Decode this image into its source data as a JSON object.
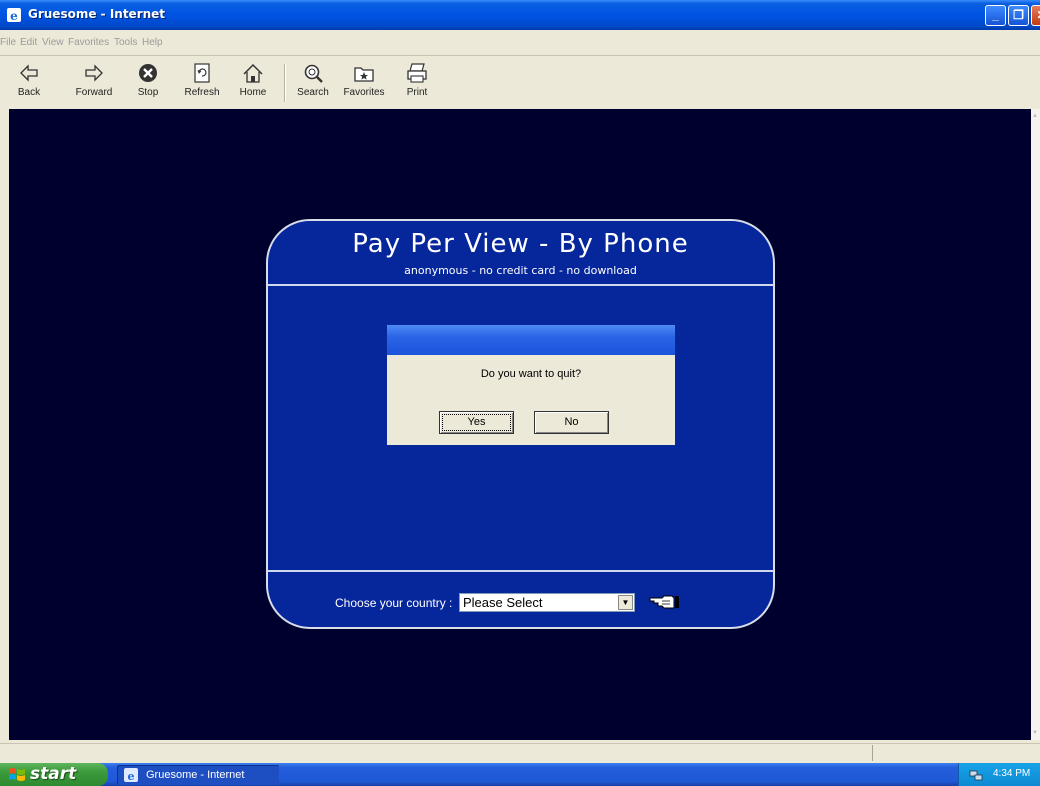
{
  "window": {
    "title": "Gruesome - Internet"
  },
  "menu": {
    "items": [
      "File",
      "Edit",
      "View",
      "Favorites",
      "Tools",
      "Help"
    ]
  },
  "toolbar": {
    "buttons": [
      {
        "label": "Back",
        "icon": "back-arrow-icon"
      },
      {
        "label": "Forward",
        "icon": "forward-arrow-icon"
      },
      {
        "label": "Stop",
        "icon": "stop-icon"
      },
      {
        "label": "Refresh",
        "icon": "refresh-icon"
      },
      {
        "label": "Home",
        "icon": "home-icon"
      },
      {
        "label": "Search",
        "icon": "search-icon"
      },
      {
        "label": "Favorites",
        "icon": "favorites-icon"
      },
      {
        "label": "Print",
        "icon": "print-icon"
      }
    ]
  },
  "ppv": {
    "title": "Pay Per View - By Phone",
    "subtitle": "anonymous - no credit card - no download",
    "country_label": "Choose your country :",
    "country_selected": "Please Select"
  },
  "dialog": {
    "message": "Do you want to quit?",
    "yes_label": "Yes",
    "no_label": "No"
  },
  "taskbar": {
    "start_label": "start",
    "task_label": "Gruesome - Internet",
    "clock": "4:34 PM"
  },
  "colors": {
    "page_background": "#00002e",
    "panel_blue": "#06269b",
    "titlebar_blue": "#0054e3",
    "start_green": "#3a9a3a"
  }
}
